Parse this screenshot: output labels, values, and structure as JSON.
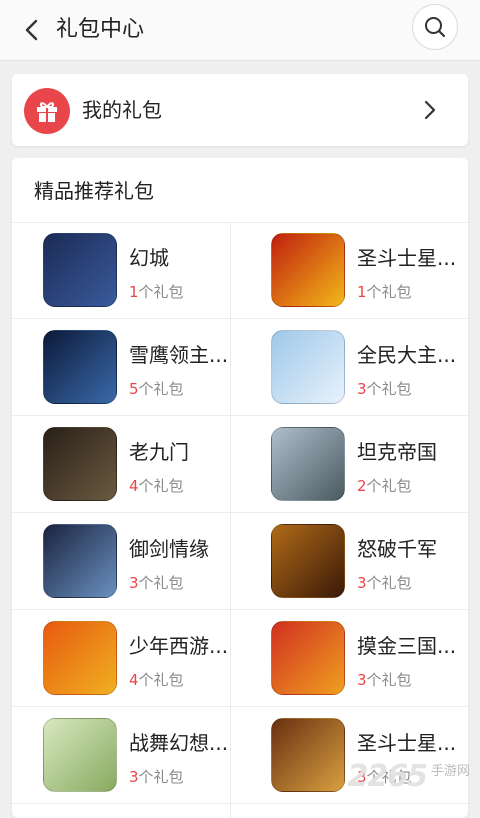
{
  "header": {
    "title": "礼包中心"
  },
  "my_gifts": {
    "label": "我的礼包"
  },
  "recommend": {
    "title": "精品推荐礼包",
    "count_suffix": "个礼包",
    "games": [
      {
        "name": "幻城",
        "count": "1",
        "icon": "huancheng-game-icon",
        "colors": [
          "#1b2b55",
          "#3a5b9c"
        ]
      },
      {
        "name": "圣斗士星...",
        "count": "1",
        "icon": "saint-seiya-game-icon",
        "colors": [
          "#c02010",
          "#f2b818"
        ]
      },
      {
        "name": "雪鹰领主...",
        "count": "5",
        "icon": "xueying-game-icon",
        "colors": [
          "#0c1a3a",
          "#3a6aaa"
        ]
      },
      {
        "name": "全民大主...",
        "count": "3",
        "icon": "quanmin-game-icon",
        "colors": [
          "#9ec8ea",
          "#e8f2fb"
        ]
      },
      {
        "name": "老九门",
        "count": "4",
        "icon": "laojiumen-game-icon",
        "colors": [
          "#2a2018",
          "#6a5a40"
        ]
      },
      {
        "name": "坦克帝国",
        "count": "2",
        "icon": "tank-empire-game-icon",
        "colors": [
          "#aebfcc",
          "#4a5a60"
        ]
      },
      {
        "name": "御剑情缘",
        "count": "3",
        "icon": "yujian-game-icon",
        "colors": [
          "#1a2440",
          "#6a90c0"
        ]
      },
      {
        "name": "怒破千军",
        "count": "3",
        "icon": "nupo-game-icon",
        "colors": [
          "#b06a18",
          "#3a1a08"
        ]
      },
      {
        "name": "少年西游...",
        "count": "4",
        "icon": "journey-west-game-icon",
        "colors": [
          "#e85a10",
          "#f0b020"
        ]
      },
      {
        "name": "摸金三国...",
        "count": "3",
        "icon": "mojin-game-icon",
        "colors": [
          "#d03020",
          "#f0a020"
        ]
      },
      {
        "name": "战舞幻想...",
        "count": "3",
        "icon": "zhanwu-game-icon",
        "colors": [
          "#d8e8c0",
          "#88aa60"
        ]
      },
      {
        "name": "圣斗士星...",
        "count": "3",
        "icon": "saint-seiya-2-game-icon",
        "colors": [
          "#6a3010",
          "#d8a040"
        ]
      }
    ]
  },
  "watermark": {
    "number": "2265",
    "text": "手游网"
  }
}
